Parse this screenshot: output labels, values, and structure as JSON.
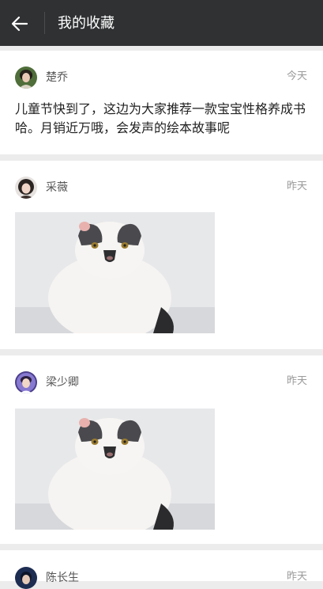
{
  "header": {
    "title": "我的收藏"
  },
  "favorites": [
    {
      "name": "楚乔",
      "time": "今天",
      "text": "儿童节快到了，这边为大家推荐一款宝宝性格养成书哈。月销近万哦，会发声的绘本故事呢"
    },
    {
      "name": "采薇",
      "time": "昨天"
    },
    {
      "name": "梁少卿",
      "time": "昨天"
    },
    {
      "name": "陈长生",
      "time": "昨天"
    }
  ],
  "colors": {
    "header_bg": "#2f3133",
    "page_bg": "#ececec",
    "card_bg": "#ffffff"
  }
}
